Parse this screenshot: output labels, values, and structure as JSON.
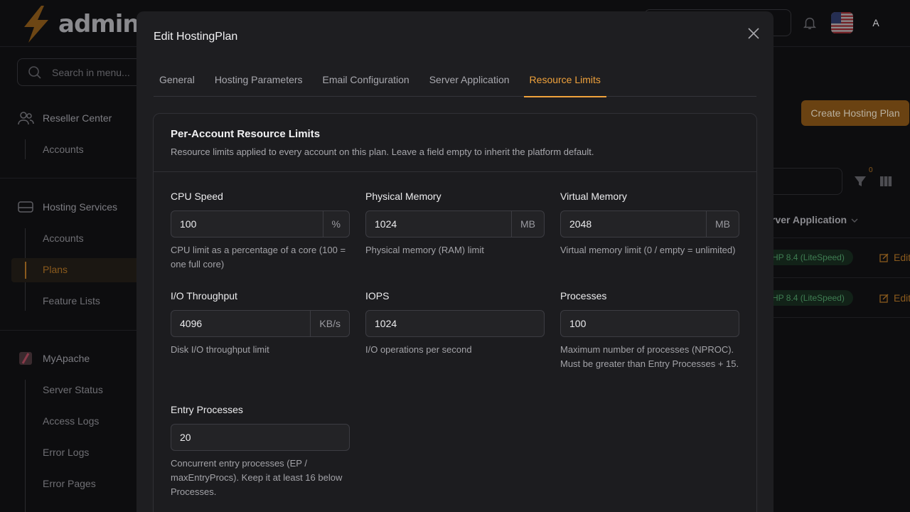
{
  "app": {
    "logo_text": "admin",
    "avatar_initial": "A"
  },
  "sidebar": {
    "search_placeholder": "Search in menu...",
    "groups": [
      {
        "label": "Reseller Center",
        "items": [
          "Accounts"
        ]
      },
      {
        "label": "Hosting Services",
        "items": [
          "Accounts",
          "Plans",
          "Feature Lists"
        ]
      },
      {
        "label": "MyApache",
        "items": [
          "Server Status",
          "Access Logs",
          "Error Logs",
          "Error Pages"
        ]
      }
    ],
    "active_item": "Plans"
  },
  "background": {
    "create_button": "Create Hosting Plan",
    "filter_count": "0",
    "column_header": "rver Application",
    "rows": [
      {
        "badge": "HP 8.4 (LiteSpeed)",
        "action": "Edit"
      },
      {
        "badge": "HP 8.4 (LiteSpeed)",
        "action": "Edit"
      }
    ]
  },
  "modal": {
    "title": "Edit HostingPlan",
    "tabs": [
      {
        "label": "General",
        "active": false
      },
      {
        "label": "Hosting Parameters",
        "active": false
      },
      {
        "label": "Email Configuration",
        "active": false
      },
      {
        "label": "Server Application",
        "active": false
      },
      {
        "label": "Resource Limits",
        "active": true
      }
    ],
    "card": {
      "title": "Per-Account Resource Limits",
      "description": "Resource limits applied to every account on this plan. Leave a field empty to inherit the platform default."
    },
    "fields": [
      {
        "label": "CPU Speed",
        "value": "100",
        "unit": "%",
        "help": "CPU limit as a percentage of a core (100 = one full core)"
      },
      {
        "label": "Physical Memory",
        "value": "1024",
        "unit": "MB",
        "help": "Physical memory (RAM) limit"
      },
      {
        "label": "Virtual Memory",
        "value": "2048",
        "unit": "MB",
        "help": "Virtual memory limit (0 / empty = unlimited)"
      },
      {
        "label": "I/O Throughput",
        "value": "4096",
        "unit": "KB/s",
        "help": "Disk I/O throughput limit"
      },
      {
        "label": "IOPS",
        "value": "1024",
        "unit": "",
        "help": "I/O operations per second"
      },
      {
        "label": "Processes",
        "value": "100",
        "unit": "",
        "help": "Maximum number of processes (NPROC). Must be greater than Entry Processes + 15."
      },
      {
        "label": "Entry Processes",
        "value": "20",
        "unit": "",
        "help": "Concurrent entry processes (EP / maxEntryProcs). Keep it at least 16 below Processes."
      }
    ]
  },
  "colors": {
    "accent": "#f0a23c",
    "modal_bg": "#1e1e21",
    "page_bg": "#0d0d0f"
  }
}
